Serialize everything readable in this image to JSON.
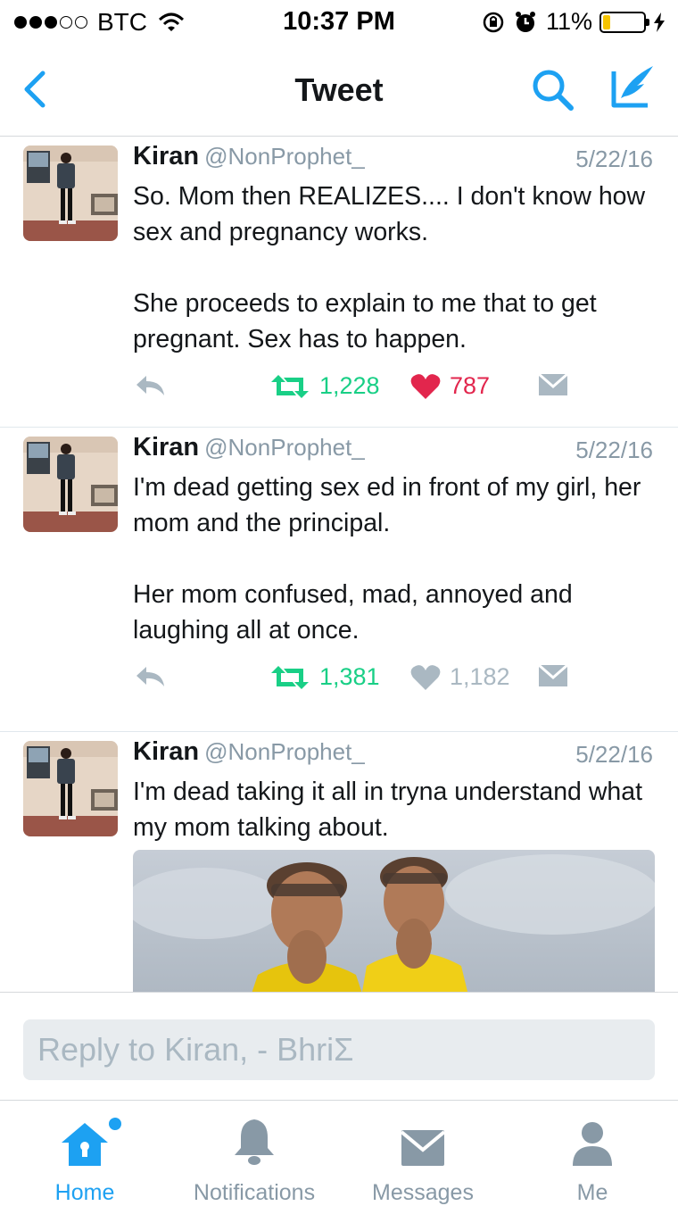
{
  "status_bar": {
    "carrier": "BTC",
    "time": "10:37 PM",
    "battery": "11%",
    "battery_level": 0.11,
    "signal_bars_filled": 3
  },
  "nav": {
    "title": "Tweet",
    "back_icon": "chevron-left-icon",
    "search_icon": "search-icon",
    "compose_icon": "compose-icon"
  },
  "tweets": [
    {
      "name": "Kiran",
      "handle": "@NonProphet_",
      "date": "5/22/16",
      "text": "So. Mom then REALIZES.... I don't know how sex and pregnancy works.\n\nShe proceeds to explain to me that to get pregnant. Sex has to happen.",
      "retweets": "1,228",
      "likes": "787",
      "liked": true
    },
    {
      "name": "Kiran",
      "handle": "@NonProphet_",
      "date": "5/22/16",
      "text": "I'm dead getting sex ed in front of my girl, her mom and the principal.\n\nHer mom confused, mad, annoyed and laughing all at once.",
      "retweets": "1,381",
      "likes": "1,182",
      "liked": false
    },
    {
      "name": "Kiran",
      "handle": "@NonProphet_",
      "date": "5/22/16",
      "text": "I'm dead taking it all in tryna understand what my mom talking about."
    }
  ],
  "reply": {
    "placeholder": "Reply to Kiran, - BhriΣ"
  },
  "tabs": [
    {
      "label": "Home",
      "icon": "home-icon",
      "active": true
    },
    {
      "label": "Notifications",
      "icon": "bell-icon",
      "active": false
    },
    {
      "label": "Messages",
      "icon": "envelope-icon",
      "active": false
    },
    {
      "label": "Me",
      "icon": "person-icon",
      "active": false
    }
  ],
  "colors": {
    "accent": "#1da1f2",
    "retweet": "#19cf86",
    "like": "#e2264d",
    "muted": "#8899a6"
  }
}
